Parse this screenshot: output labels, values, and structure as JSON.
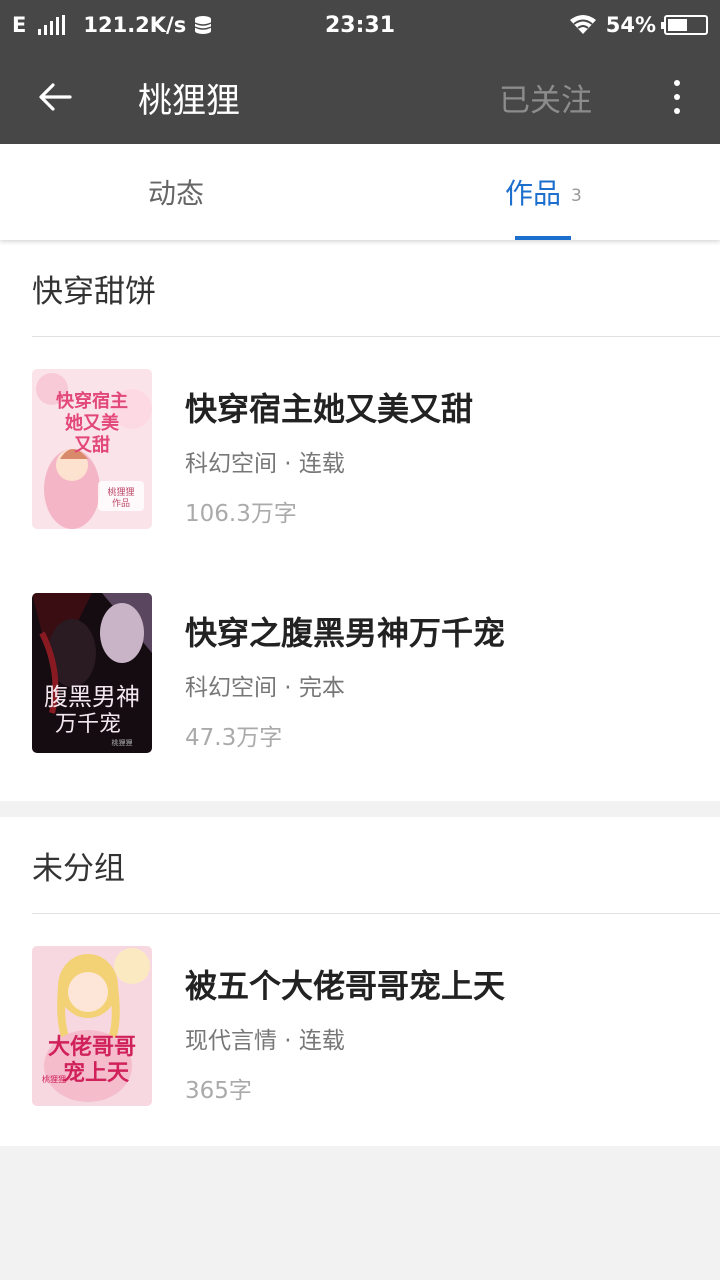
{
  "status_bar": {
    "network_type": "E",
    "speed": "121.2K/s",
    "time": "23:31",
    "battery": "54%",
    "battery_level": 0.54
  },
  "app_bar": {
    "title": "桃狸狸",
    "follow_label": "已关注"
  },
  "tabs": [
    {
      "label": "动态",
      "count": ""
    },
    {
      "label": "作品",
      "count": "3"
    }
  ],
  "groups": [
    {
      "name": "快穿甜饼",
      "books": [
        {
          "title": "快穿宿主她又美又甜",
          "meta": "科幻空间 · 连载",
          "words": "106.3万字",
          "cover_text": "快穿宿主她又美又甜",
          "cover_author": "桃狸狸作品"
        },
        {
          "title": "快穿之腹黑男神万千宠",
          "meta": "科幻空间 · 完本",
          "words": "47.3万字",
          "cover_text": "腹黑男神万千宠",
          "cover_author": "桃狸狸"
        }
      ]
    },
    {
      "name": "未分组",
      "books": [
        {
          "title": "被五个大佬哥哥宠上天",
          "meta": "现代言情 · 连载",
          "words": "365字",
          "cover_text": "大佬哥哥宠上天",
          "cover_author": "桃狸狸"
        }
      ]
    }
  ],
  "colors": {
    "header_bg": "#474747",
    "accent": "#1d6fce",
    "page_bg": "#f2f2f2"
  }
}
